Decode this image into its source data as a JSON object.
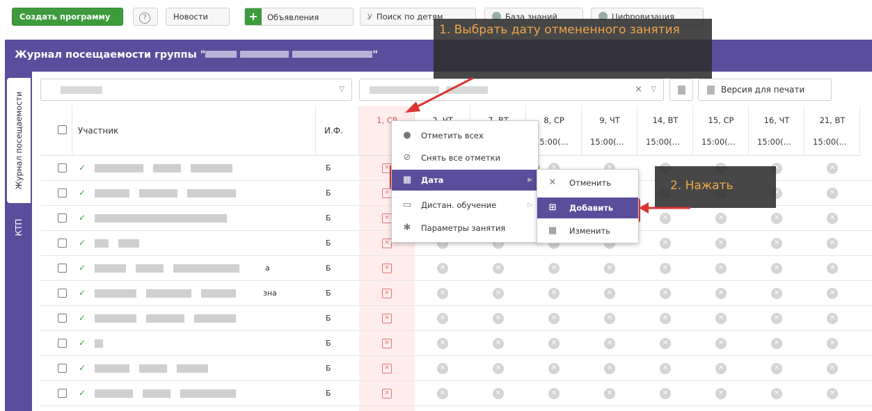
{
  "toolbar": {
    "create_program": "Создать программу",
    "help": "?",
    "news": "Новости",
    "ads": "Объявления",
    "child_search": "Поиск по детям",
    "knowledge_base": "База знаний",
    "digitalization": "Цифровизация"
  },
  "header": {
    "title_prefix": "Журнал посещаемости группы \"",
    "title_suffix": "\""
  },
  "side_tabs": {
    "journal": "Журнал посещаемости",
    "ktp": "КТП"
  },
  "filters": {
    "print_version": "Версия для печати",
    "clear": "×",
    "caret": "▽"
  },
  "table": {
    "col_participant": "Участник",
    "col_if": "И.Ф.",
    "days": [
      "1, СР",
      "2, ЧТ",
      "7, ВТ",
      "8, СР",
      "9, ЧТ",
      "14, ВТ",
      "15, СР",
      "16, ЧТ",
      "21, ВТ"
    ],
    "times": [
      "15:00(...",
      "15:00(...",
      "15:00(...",
      "15:00(...",
      "15:00(...",
      "15:00(..."
    ],
    "if_value": "Б",
    "row_tail_1": "a",
    "row_tail_2": "зна"
  },
  "context_menu": {
    "mark_all": "Отметить всех",
    "unmark_all": "Снять все отметки",
    "date": "Дата",
    "remote": "Дистан. обучение",
    "lesson_params": "Параметры занятия"
  },
  "submenu": {
    "cancel": "Отменить",
    "add": "Добавить",
    "edit": "Изменить"
  },
  "annotations": {
    "step1": "1. Выбрать дату отмененного занятия",
    "step2": "2. Нажать"
  },
  "colors": {
    "accent": "#5a4e9c",
    "green": "#3d9b3d",
    "highlight": "#d33333",
    "annotation_text": "#f2a44a"
  }
}
